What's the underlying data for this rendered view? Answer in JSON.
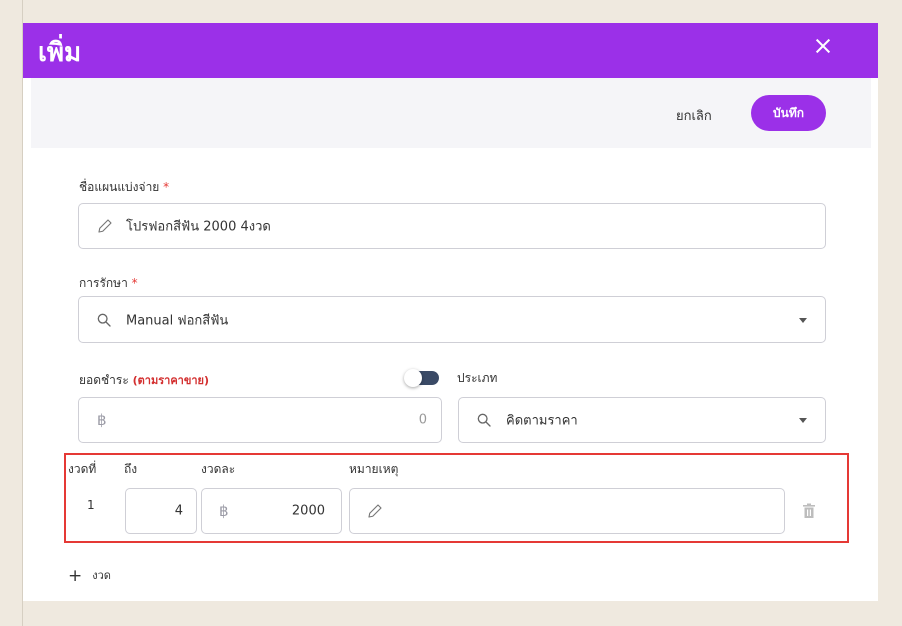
{
  "dialog": {
    "title": "เพิ่ม",
    "cancel_label": "ยกเลิก",
    "save_label": "บันทึก"
  },
  "form": {
    "plan_name_label": "ชื่อแผนแบ่งจ่าย",
    "required_mark": "*",
    "plan_name_value": "โปรฟอกสีฟัน 2000 4งวด",
    "treatment_label": "การรักษา",
    "treatment_value": "Manual ฟอกสีฟัน",
    "payment_label": "ยอดชำระ",
    "payment_note": "(ตามราคาขาย)",
    "currency_symbol": "฿",
    "payment_value": "0",
    "type_label": "ประเภท",
    "type_value": "คิดตามราคา"
  },
  "installments": {
    "headers": {
      "from": "งวดที่",
      "to": "ถึง",
      "per": "งวดละ",
      "note": "หมายเหตุ"
    },
    "rows": [
      {
        "from": "1",
        "to": "4",
        "amount": "2000",
        "note": ""
      }
    ],
    "add_label": "งวด"
  },
  "icons": [
    "close-icon",
    "pencil-icon",
    "search-icon",
    "chevron-down-icon",
    "baht-icon",
    "trash-icon",
    "plus-icon"
  ],
  "colors": {
    "primary": "#9b30e8",
    "highlight": "#e53935",
    "background": "#efe9df"
  }
}
